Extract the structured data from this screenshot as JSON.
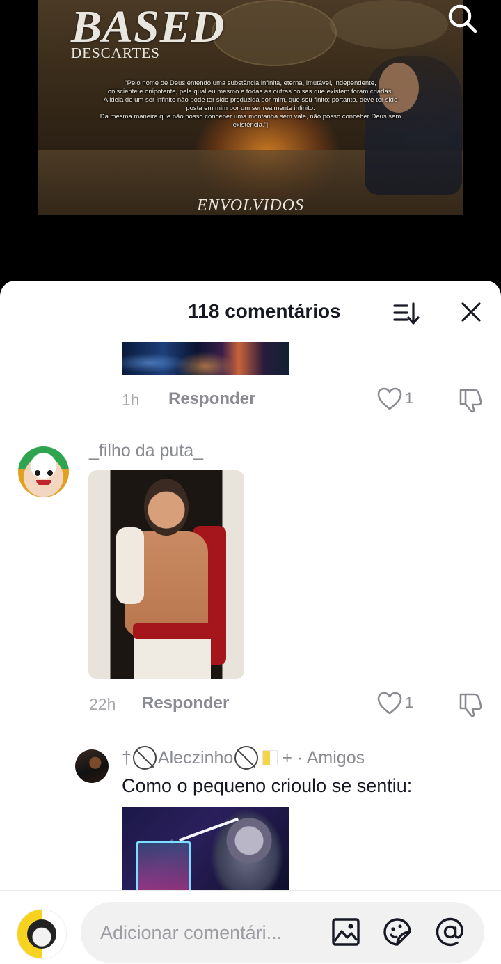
{
  "video": {
    "title": "BASED",
    "subtitle": "DESCARTES",
    "quote_lines": [
      "\"Pelo nome de Deus entendo uma substância infinita, eterna, imutável, independente,",
      "onisciente e onipotente, pela qual eu mesmo e todas as outras coisas que existem foram criadas.",
      "A ideia de um ser infinito não pode ter sido produzida por mim, que sou finito; portanto, deve ter sido",
      "posta em mim por um ser realmente infinito.",
      "Da mesma maneira que não posso conceber uma montanha sem vale, não posso conceber Deus sem",
      "existência.\"|"
    ],
    "footer": "ENVOLVIDOS"
  },
  "sheet": {
    "title": "118 comentários"
  },
  "comments": [
    {
      "time": "1h",
      "reply_label": "Responder",
      "likes": "1"
    },
    {
      "username": "_filho da puta_",
      "time": "22h",
      "reply_label": "Responder",
      "likes": "1"
    }
  ],
  "reply": {
    "prefix": "†",
    "username": "Aleczinho",
    "suffix": "+ · Amigos",
    "text": "Como o pequeno crioulo se sentiu:"
  },
  "composer": {
    "placeholder": "Adicionar comentári..."
  }
}
